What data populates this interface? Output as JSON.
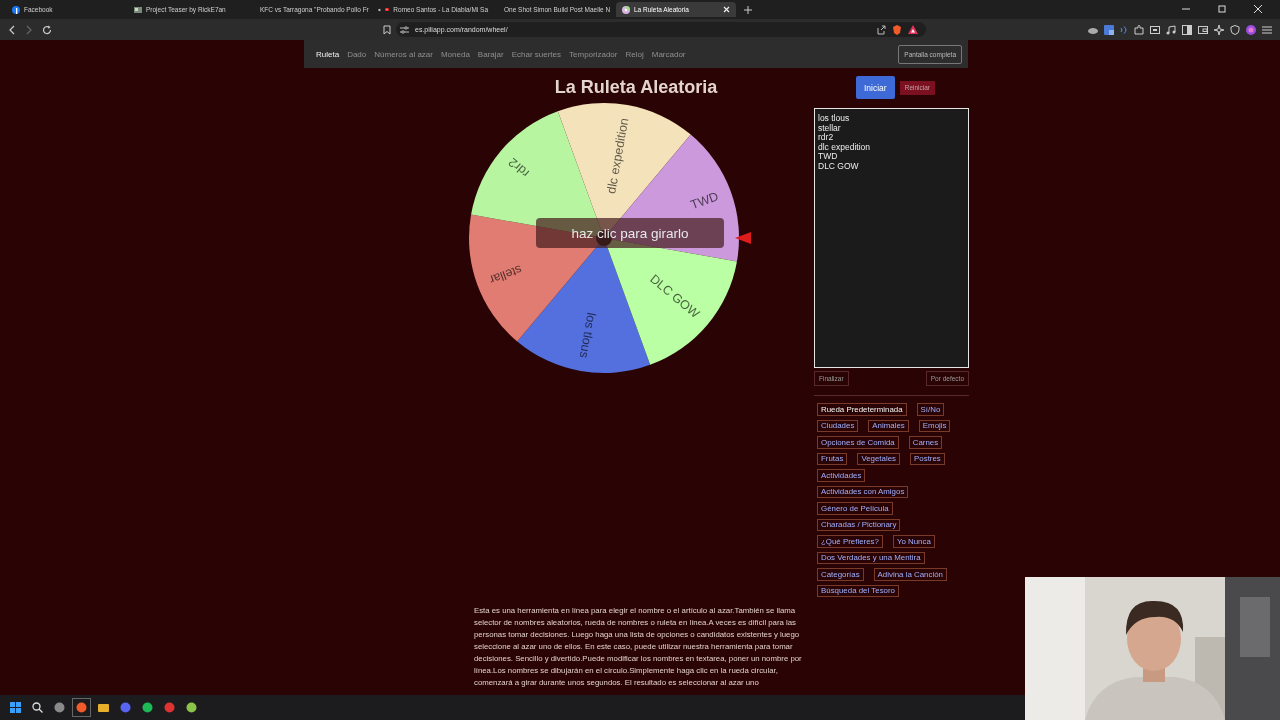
{
  "browser": {
    "tabs": [
      {
        "title": "Facebook",
        "kind": "facebook",
        "selected": false
      },
      {
        "title": "Project Teaser by RickE7an",
        "kind": "page",
        "selected": false
      },
      {
        "title": "KFC vs Tarragona \"Probando Pollo Fr",
        "kind": "video",
        "selected": false
      },
      {
        "title": "Romeo Santos - La Diabla/Mi Sa",
        "kind": "video-playing",
        "selected": false
      },
      {
        "title": "One Shot Simon Build Post Maelle N",
        "kind": "video",
        "selected": false
      },
      {
        "title": "La Ruleta Aleatoria",
        "kind": "site",
        "selected": true
      }
    ],
    "address": "es.piliapp.com/random/wheel/"
  },
  "nav": {
    "items": [
      {
        "label": "Ruleta",
        "selected": true
      },
      {
        "label": "Dado",
        "selected": false
      },
      {
        "label": "Números al azar",
        "selected": false
      },
      {
        "label": "Moneda",
        "selected": false
      },
      {
        "label": "Barajar",
        "selected": false
      },
      {
        "label": "Echar suertes",
        "selected": false
      },
      {
        "label": "Temporizador",
        "selected": false
      },
      {
        "label": "Reloj",
        "selected": false
      },
      {
        "label": "Marcador",
        "selected": false
      }
    ],
    "fullscreen_button": "Pantalla completa"
  },
  "title": "La Ruleta Aleatoria",
  "start_button": "Iniciar",
  "reset_button": "Reiniciar",
  "wheel": {
    "segments": [
      {
        "label": "los tlous",
        "color": "#5470de"
      },
      {
        "label": "stellar",
        "color": "#e07c72"
      },
      {
        "label": "rdr2",
        "color": "#b7f5a1"
      },
      {
        "label": "dlc expedition",
        "color": "#f3e2ba"
      },
      {
        "label": "TWD",
        "color": "#cc99dd"
      },
      {
        "label": "DLC GOW",
        "color": "#baffa4"
      }
    ],
    "overlay": "haz clic para girarlo"
  },
  "name_list": {
    "lines": [
      "los tlous",
      "stellar",
      "rdr2",
      "dlc expedition",
      "TWD",
      "DLC GOW"
    ],
    "finish_button": "Finalizar",
    "default_button": "Por defecto"
  },
  "presets": [
    {
      "label": "Rueda Predeterminada",
      "selected": true
    },
    {
      "label": "Sí/No",
      "selected": false
    },
    {
      "label": "Ciudades",
      "selected": false
    },
    {
      "label": "Animales",
      "selected": false
    },
    {
      "label": "Emojis",
      "selected": false
    },
    {
      "label": "Opciones de Comida",
      "selected": false
    },
    {
      "label": "Carnes",
      "selected": false
    },
    {
      "label": "Frutas",
      "selected": false
    },
    {
      "label": "Vegetales",
      "selected": false
    },
    {
      "label": "Postres",
      "selected": false
    },
    {
      "label": "Actividades",
      "selected": false
    },
    {
      "label": "Actividades con Amigos",
      "selected": false
    },
    {
      "label": "Género de Película",
      "selected": false
    },
    {
      "label": "Charadas / Pictionary",
      "selected": false
    },
    {
      "label": "¿Qué Prefieres?",
      "selected": false
    },
    {
      "label": "Yo Nunca",
      "selected": false
    },
    {
      "label": "Dos Verdades y una Mentira",
      "selected": false
    },
    {
      "label": "Categorías",
      "selected": false
    },
    {
      "label": "Adivina la Canción",
      "selected": false
    },
    {
      "label": "Búsqueda del Tesoro",
      "selected": false
    }
  ],
  "description": "Esta es una herramienta en línea para elegir el nombre o el artículo al azar.También se llama selector de nombres aleatorios, rueda de nombres o ruleta en línea.A veces es difícil para las personas tomar decisiones. Luego haga una lista de opciones o candidatos existentes y luego seleccione al azar uno de ellos. En este caso, puede utilizar nuestra herramienta para tomar decisiones. Sencillo y divertido.Puede modificar los nombres en textarea, poner un nombre por línea.Los nombres se dibujarán en el círculo.Simplemente haga clic en la rueda circular, comenzará a girar durante unos segundos. El resultado es seleccionar al azar uno"
}
